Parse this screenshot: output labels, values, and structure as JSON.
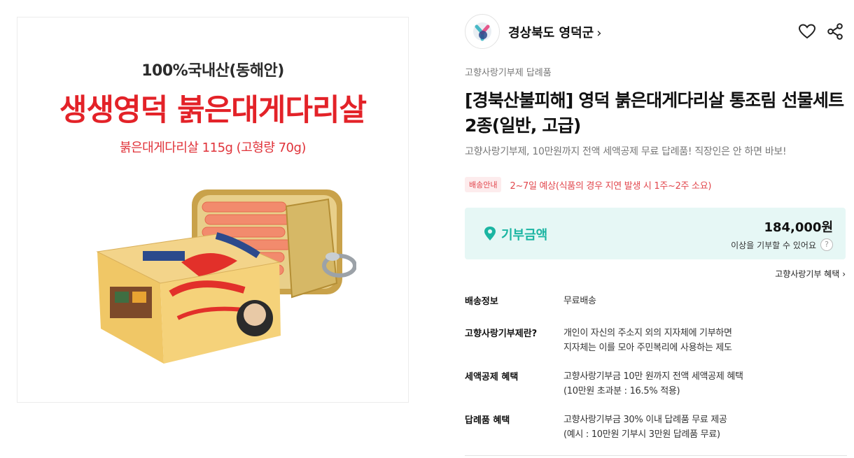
{
  "product_image": {
    "kicker": "100%국내산(동해안)",
    "headline": "생생영덕 붉은대게다리살",
    "subline": "붉은대게다리살 115g (고형량 70g)"
  },
  "seller": {
    "name": "경상북도 영덕군",
    "chevron": "›",
    "logo_icon": "yeongdeok-logo"
  },
  "product": {
    "category": "고향사랑기부제 답례품",
    "title": "[경북산불피해] 영덕 붉은대게다리살 통조림 선물세트 2종(일반, 고급)",
    "subtitle": "고향사랑기부제, 10만원까지 전액 세액공제 무료 답례품! 직장인은 안 하면 바보!"
  },
  "shipping_notice": {
    "badge": "배송안내",
    "text": "2~7일 예상(식품의 경우 지연 발생 시 1주~2주 소요)"
  },
  "donation": {
    "label": "기부금액",
    "amount": "184,000원",
    "note": "이상을 기부할 수 있어요",
    "help": "?"
  },
  "benefit_link": "고향사랑기부 혜택 ›",
  "info": [
    {
      "label": "배송정보",
      "lines": [
        "무료배송"
      ]
    },
    {
      "label": "고향사랑기부제란?",
      "lines": [
        "개인이 자신의 주소지 외의 지자체에 기부하면",
        "지자체는 이를 모아 주민복리에 사용하는 제도"
      ]
    },
    {
      "label": "세액공제 혜택",
      "lines": [
        "고향사랑기부금 10만 원까지 전액 세액공제 혜택",
        "(10만원 초과분 : 16.5% 적용)"
      ]
    },
    {
      "label": "답례품 혜택",
      "lines": [
        "고향사랑기부금 30% 이내 답례품 무료 제공",
        "(예시 : 10만원 기부시 3만원 답례품 무료)"
      ]
    }
  ],
  "colors": {
    "accent_teal": "#1bb5a2",
    "donation_bg": "#e6f7f5",
    "alert_red": "#e2474d",
    "headline_red": "#e32228"
  }
}
